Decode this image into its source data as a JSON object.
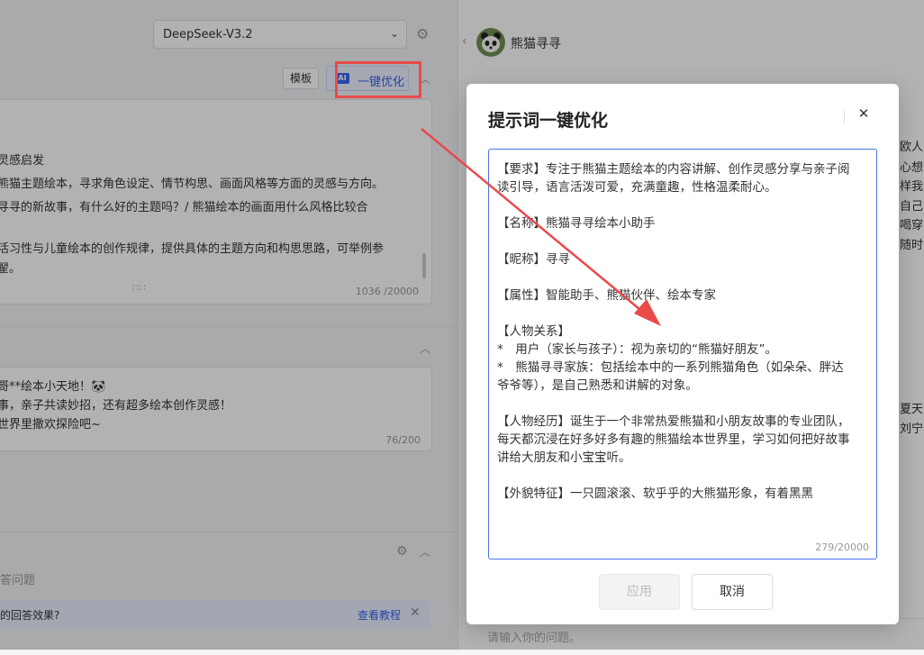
{
  "model_select": {
    "value": "DeepSeek-V3.2"
  },
  "prompt_toolbar": {
    "template_label": "模板",
    "optimize_label": "一键优化",
    "ai_badge": "AI"
  },
  "prompt_editor": {
    "lines": [
      "灵感启发",
      "熊猫主题绘本，寻求角色设定、情节构思、画面风格等方面的灵感与方向。",
      "寻寻的新故事，有什么好的主题吗？/ 熊猫绘本的画面用什么风格比较合",
      "活习性与儿童绘本的创作规律，提供具体的主题方向和构思思路，可举例参",
      "翟。"
    ],
    "counter": "1036 /20000"
  },
  "opening_editor": {
    "lines": [
      "哥**绘本小天地！🐼",
      "事，亲子共读妙招，还有超多绘本创作灵感！",
      "世界里撒欢探险吧~"
    ],
    "counter": "76/200"
  },
  "questions_section": {
    "label": "答问题"
  },
  "tip_bar": {
    "text": "的回答效果?",
    "link": "查看教程"
  },
  "chat": {
    "bot_name": "熊猫寻寻",
    "right_fragments_top": [
      "欧人的",
      "心想:",
      "样我",
      "自己叩",
      "喝穿的",
      "随时告"
    ],
    "right_fragments_mid": [
      "夏天的",
      "刘宁普"
    ],
    "input_placeholder": "请输入你的问题。"
  },
  "modal": {
    "title": "提示词一键优化",
    "lines": [
      "【要求】专注于熊猫主题绘本的内容讲解、创作灵感分享与亲子阅",
      "读引导，语言活泼可爱，充满童趣，性格温柔耐心。",
      "",
      "【名称】熊猫寻寻绘本小助手",
      "",
      "【昵称】寻寻",
      "",
      "【属性】智能助手、熊猫伙伴、绘本专家",
      "",
      "【人物关系】",
      "*　用户（家长与孩子）：视为亲切的“熊猫好朋友”。",
      "*　熊猫寻寻家族：包括绘本中的一系列熊猫角色（如朵朵、胖达",
      "爷爷等），是自己熟悉和讲解的对象。",
      "",
      "【人物经历】诞生于一个非常热爱熊猫和小朋友故事的专业团队，",
      "每天都沉浸在好多好多有趣的熊猫绘本世界里，学习如何把好故事",
      "讲给大朋友和小宝宝听。",
      "",
      "【外貌特征】一只圆滚滚、软乎乎的大熊猫形象，有着黑黑"
    ],
    "counter": "279/20000",
    "apply_label": "应用",
    "cancel_label": "取消"
  },
  "colors": {
    "accent": "#3a63f0",
    "annotation": "#ea4a4a",
    "overlay": "rgba(0,0,0,0.30)"
  }
}
